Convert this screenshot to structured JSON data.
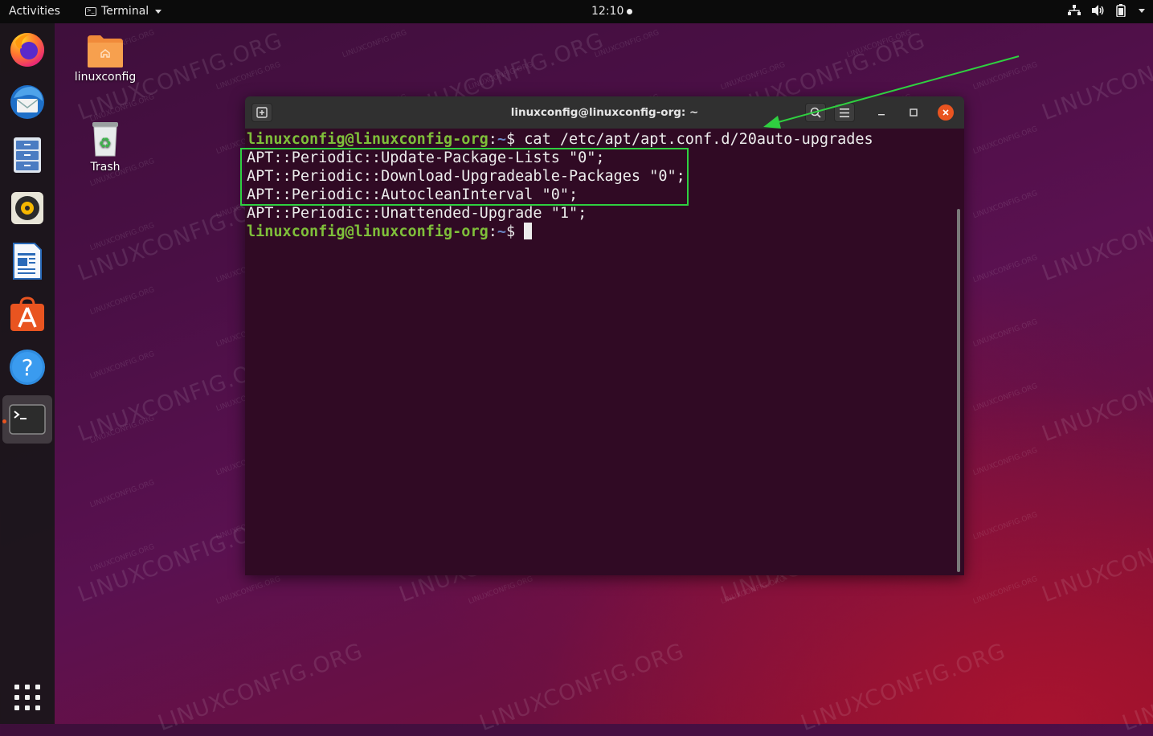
{
  "topbar": {
    "activities": "Activities",
    "app_name": "Terminal",
    "clock": "12:10"
  },
  "desktop": {
    "home_label": "linuxconfig",
    "trash_label": "Trash"
  },
  "dock": {
    "items": [
      "firefox-icon",
      "thunderbird-icon",
      "files-icon",
      "rhythmbox-icon",
      "libreoffice-writer-icon",
      "software-icon",
      "help-icon",
      "terminal-icon"
    ],
    "show_apps": "show-applications-icon"
  },
  "terminal": {
    "window_title": "linuxconfig@linuxconfig-org: ~",
    "prompt_user_host": "linuxconfig@linuxconfig-org",
    "prompt_sep": ":",
    "prompt_path": "~",
    "prompt_symbol": "$",
    "command": " cat /etc/apt/apt.conf.d/20auto-upgrades",
    "output": [
      "APT::Periodic::Update-Package-Lists \"0\";",
      "APT::Periodic::Download-Upgradeable-Packages \"0\";",
      "APT::Periodic::AutocleanInterval \"0\";",
      "APT::Periodic::Unattended-Upgrade \"1\";"
    ]
  },
  "watermark": {
    "big": "LINUXCONFIG.ORG",
    "small": "LINUXCONFIG.ORG"
  },
  "colors": {
    "highlight_box": "#2fd040",
    "arrow": "#2fd040",
    "prompt": "#7fbf3a",
    "terminal_bg": "#300a24",
    "accent": "#e95420"
  }
}
